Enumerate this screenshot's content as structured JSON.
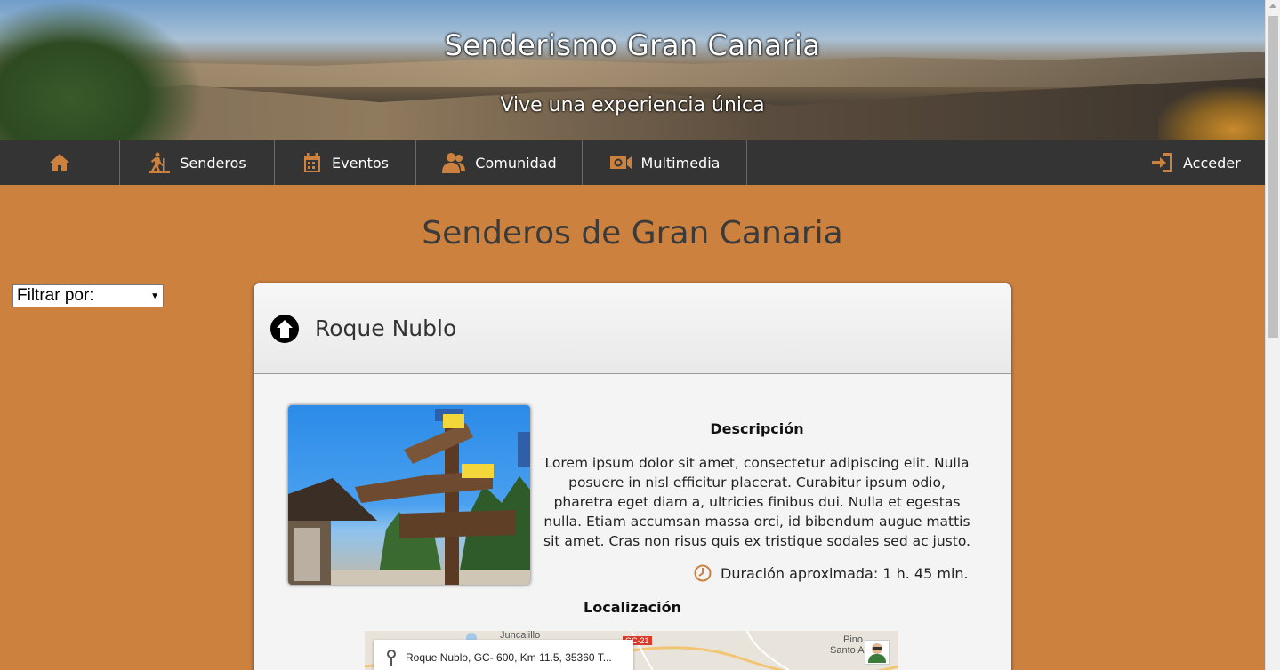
{
  "header": {
    "title": "Senderismo Gran Canaria",
    "subtitle": "Vive una experiencia única"
  },
  "nav": {
    "home_icon": "home-icon",
    "items": [
      {
        "label": "Senderos",
        "icon": "hiker-icon"
      },
      {
        "label": "Eventos",
        "icon": "calendar-icon"
      },
      {
        "label": "Comunidad",
        "icon": "users-icon"
      },
      {
        "label": "Multimedia",
        "icon": "camera-icon"
      }
    ],
    "login": {
      "label": "Acceder",
      "icon": "login-icon"
    }
  },
  "page": {
    "title": "Senderos de Gran Canaria"
  },
  "filter": {
    "selected": "Filtrar por:"
  },
  "trail": {
    "name": "Roque Nublo",
    "description_title": "Descripción",
    "description": "Lorem ipsum dolor sit amet, consectetur adipiscing elit. Nulla posuere in nisl efficitur placerat. Curabitur ipsum odio, pharetra eget diam a, ultricies finibus dui. Nulla et egestas nulla. Etiam accumsan massa orci, id bibendum augue mattis sit amet. Cras non risus quis ex tristique sodales sed ac justo.",
    "duration": "Duración aproximada: 1 h. 45 min.",
    "location_title": "Localización",
    "map": {
      "address": "Roque Nublo, GC- 600, Km 11.5, 35360 T...",
      "place_1": "Juncalillo",
      "place_2": "Pino",
      "place_3": "Santo A",
      "road": "GC-21"
    }
  },
  "colors": {
    "accent": "#cd813f",
    "nav_bg": "#343434",
    "card_bg": "#f4f4f4"
  }
}
